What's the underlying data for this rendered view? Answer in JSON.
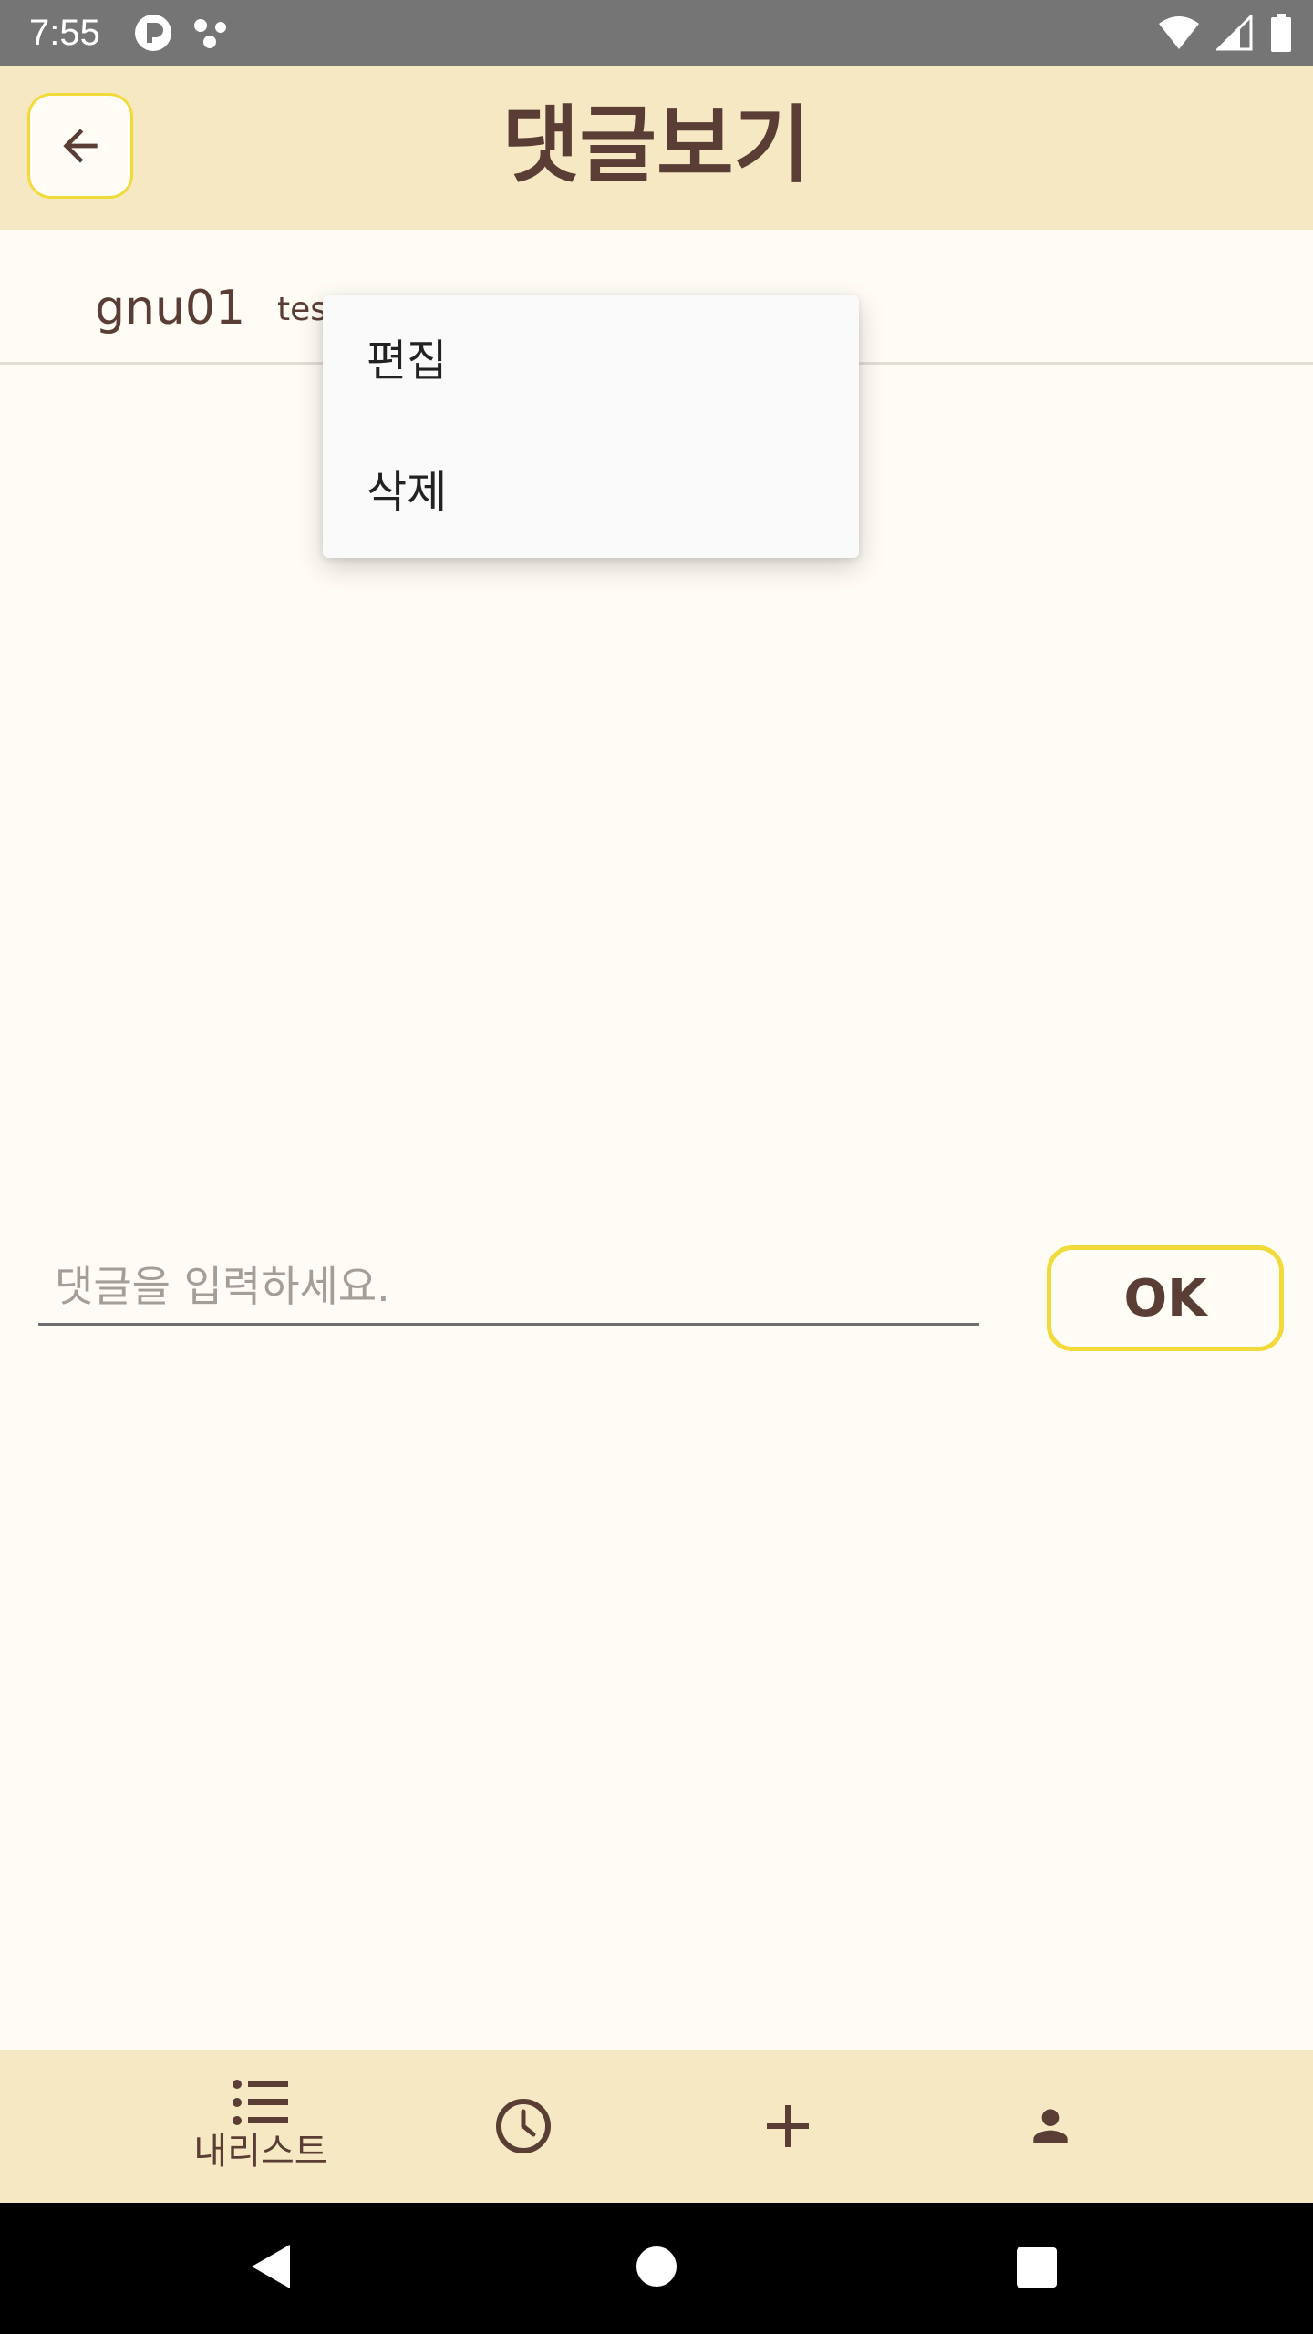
{
  "status_bar": {
    "time": "7:55"
  },
  "app_bar": {
    "title": "댓글보기"
  },
  "comment": {
    "user": "gnu01",
    "text": "tes"
  },
  "context_menu": {
    "items": [
      {
        "label": "편집"
      },
      {
        "label": "삭제"
      }
    ]
  },
  "input": {
    "placeholder": "댓글을 입력하세요.",
    "value": ""
  },
  "ok_button": {
    "label": "OK"
  },
  "bottom_nav": {
    "items": [
      {
        "label": "내리스트",
        "icon": "list-icon"
      },
      {
        "icon": "clock-icon"
      },
      {
        "icon": "plus-icon"
      },
      {
        "icon": "person-icon"
      }
    ]
  },
  "colors": {
    "brown": "#5A3E36",
    "cream": "#F6E8C2",
    "yellow_border": "#F2DA3B",
    "background": "#FFFBF5"
  }
}
